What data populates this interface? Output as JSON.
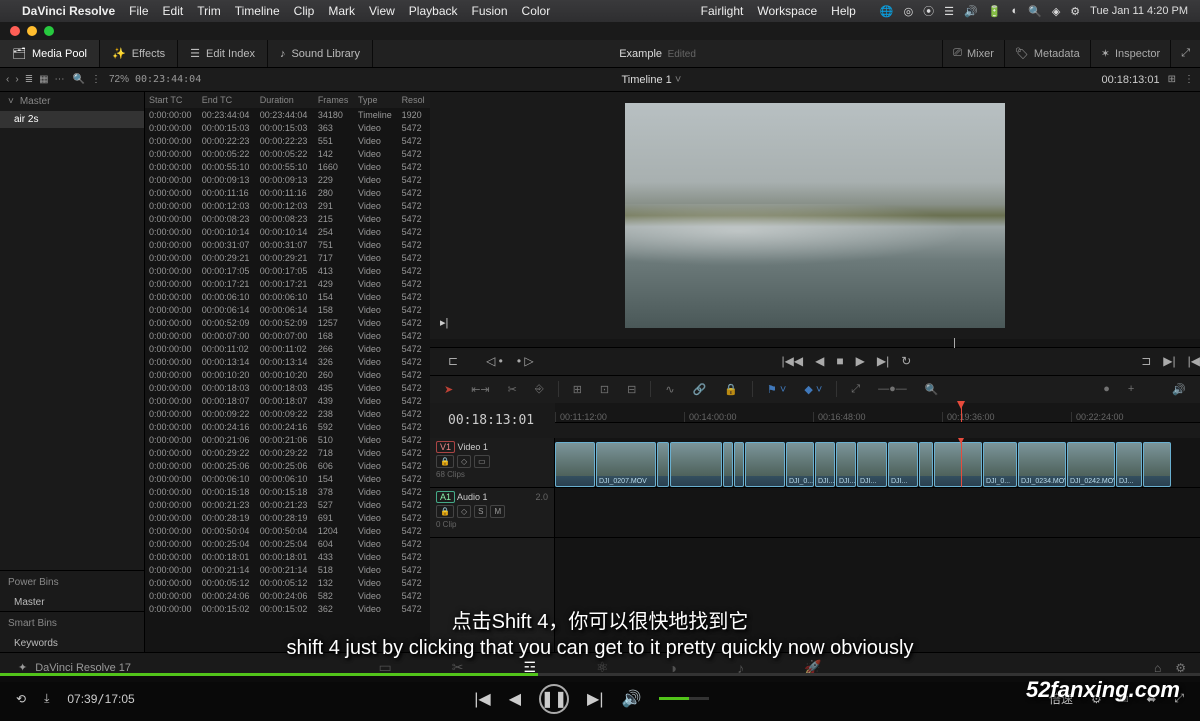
{
  "menubar": {
    "app": "DaVinci Resolve",
    "items": [
      "File",
      "Edit",
      "Trim",
      "Timeline",
      "Clip",
      "Mark",
      "View",
      "Playback",
      "Fusion",
      "Color"
    ],
    "right_items": [
      "Fairlight",
      "Workspace",
      "Help"
    ],
    "clock": "Tue Jan 11  4:20 PM"
  },
  "tabbar": {
    "media_pool": "Media Pool",
    "effects": "Effects",
    "edit_index": "Edit Index",
    "sound_library": "Sound Library",
    "title": "Example",
    "subtitle": "Edited",
    "mixer": "Mixer",
    "metadata": "Metadata",
    "inspector": "Inspector"
  },
  "subbar": {
    "zoom": "72%",
    "tc": "00:23:44:04",
    "timeline_name": "Timeline 1",
    "right_tc": "00:18:13:01"
  },
  "bins": {
    "master": "Master",
    "folder": "air 2s",
    "power_bins": "Power Bins",
    "power_master": "Master",
    "smart_bins": "Smart Bins",
    "keywords": "Keywords"
  },
  "media_table": {
    "headers": [
      "Start TC",
      "End TC",
      "Duration",
      "Frames",
      "Type",
      "Resol"
    ],
    "rows": [
      [
        "0:00:00:00",
        "00:23:44:04",
        "00:23:44:04",
        "34180",
        "Timeline",
        "1920"
      ],
      [
        "0:00:00:00",
        "00:00:15:03",
        "00:00:15:03",
        "363",
        "Video",
        "5472"
      ],
      [
        "0:00:00:00",
        "00:00:22:23",
        "00:00:22:23",
        "551",
        "Video",
        "5472"
      ],
      [
        "0:00:00:00",
        "00:00:05:22",
        "00:00:05:22",
        "142",
        "Video",
        "5472"
      ],
      [
        "0:00:00:00",
        "00:00:55:10",
        "00:00:55:10",
        "1660",
        "Video",
        "5472"
      ],
      [
        "0:00:00:00",
        "00:00:09:13",
        "00:00:09:13",
        "229",
        "Video",
        "5472"
      ],
      [
        "0:00:00:00",
        "00:00:11:16",
        "00:00:11:16",
        "280",
        "Video",
        "5472"
      ],
      [
        "0:00:00:00",
        "00:00:12:03",
        "00:00:12:03",
        "291",
        "Video",
        "5472"
      ],
      [
        "0:00:00:00",
        "00:00:08:23",
        "00:00:08:23",
        "215",
        "Video",
        "5472"
      ],
      [
        "0:00:00:00",
        "00:00:10:14",
        "00:00:10:14",
        "254",
        "Video",
        "5472"
      ],
      [
        "0:00:00:00",
        "00:00:31:07",
        "00:00:31:07",
        "751",
        "Video",
        "5472"
      ],
      [
        "0:00:00:00",
        "00:00:29:21",
        "00:00:29:21",
        "717",
        "Video",
        "5472"
      ],
      [
        "0:00:00:00",
        "00:00:17:05",
        "00:00:17:05",
        "413",
        "Video",
        "5472"
      ],
      [
        "0:00:00:00",
        "00:00:17:21",
        "00:00:17:21",
        "429",
        "Video",
        "5472"
      ],
      [
        "0:00:00:00",
        "00:00:06:10",
        "00:00:06:10",
        "154",
        "Video",
        "5472"
      ],
      [
        "0:00:00:00",
        "00:00:06:14",
        "00:00:06:14",
        "158",
        "Video",
        "5472"
      ],
      [
        "0:00:00:00",
        "00:00:52:09",
        "00:00:52:09",
        "1257",
        "Video",
        "5472"
      ],
      [
        "0:00:00:00",
        "00:00:07:00",
        "00:00:07:00",
        "168",
        "Video",
        "5472"
      ],
      [
        "0:00:00:00",
        "00:00:11:02",
        "00:00:11:02",
        "266",
        "Video",
        "5472"
      ],
      [
        "0:00:00:00",
        "00:00:13:14",
        "00:00:13:14",
        "326",
        "Video",
        "5472"
      ],
      [
        "0:00:00:00",
        "00:00:10:20",
        "00:00:10:20",
        "260",
        "Video",
        "5472"
      ],
      [
        "0:00:00:00",
        "00:00:18:03",
        "00:00:18:03",
        "435",
        "Video",
        "5472"
      ],
      [
        "0:00:00:00",
        "00:00:18:07",
        "00:00:18:07",
        "439",
        "Video",
        "5472"
      ],
      [
        "0:00:00:00",
        "00:00:09:22",
        "00:00:09:22",
        "238",
        "Video",
        "5472"
      ],
      [
        "0:00:00:00",
        "00:00:24:16",
        "00:00:24:16",
        "592",
        "Video",
        "5472"
      ],
      [
        "0:00:00:00",
        "00:00:21:06",
        "00:00:21:06",
        "510",
        "Video",
        "5472"
      ],
      [
        "0:00:00:00",
        "00:00:29:22",
        "00:00:29:22",
        "718",
        "Video",
        "5472"
      ],
      [
        "0:00:00:00",
        "00:00:25:06",
        "00:00:25:06",
        "606",
        "Video",
        "5472"
      ],
      [
        "0:00:00:00",
        "00:00:06:10",
        "00:00:06:10",
        "154",
        "Video",
        "5472"
      ],
      [
        "0:00:00:00",
        "00:00:15:18",
        "00:00:15:18",
        "378",
        "Video",
        "5472"
      ],
      [
        "0:00:00:00",
        "00:00:21:23",
        "00:00:21:23",
        "527",
        "Video",
        "5472"
      ],
      [
        "0:00:00:00",
        "00:00:28:19",
        "00:00:28:19",
        "691",
        "Video",
        "5472"
      ],
      [
        "0:00:00:00",
        "00:00:50:04",
        "00:00:50:04",
        "1204",
        "Video",
        "5472"
      ],
      [
        "0:00:00:00",
        "00:00:25:04",
        "00:00:25:04",
        "604",
        "Video",
        "5472"
      ],
      [
        "0:00:00:00",
        "00:00:18:01",
        "00:00:18:01",
        "433",
        "Video",
        "5472"
      ],
      [
        "0:00:00:00",
        "00:00:21:14",
        "00:00:21:14",
        "518",
        "Video",
        "5472"
      ],
      [
        "0:00:00:00",
        "00:00:05:12",
        "00:00:05:12",
        "132",
        "Video",
        "5472"
      ],
      [
        "0:00:00:00",
        "00:00:24:06",
        "00:00:24:06",
        "582",
        "Video",
        "5472"
      ],
      [
        "0:00:00:00",
        "00:00:15:02",
        "00:00:15:02",
        "362",
        "Video",
        "5472"
      ]
    ]
  },
  "timeline": {
    "tc_display": "00:18:13:01",
    "ruler": [
      "00:11:12:00",
      "00:14:00:00",
      "00:16:48:00",
      "00:19:36:00",
      "00:22:24:00"
    ],
    "video_track": {
      "id": "V1",
      "name": "Video 1",
      "clips_info": "68 Clips"
    },
    "audio_track": {
      "id": "A1",
      "name": "Audio 1",
      "level": "2.0",
      "clips_info": "0 Clip"
    },
    "clips": [
      {
        "w": 40,
        "label": ""
      },
      {
        "w": 60,
        "label": "DJI_0207.MOV"
      },
      {
        "w": 12,
        "label": ""
      },
      {
        "w": 52,
        "label": ""
      },
      {
        "w": 10,
        "label": ""
      },
      {
        "w": 10,
        "label": ""
      },
      {
        "w": 40,
        "label": ""
      },
      {
        "w": 28,
        "label": "DJI_0..."
      },
      {
        "w": 20,
        "label": "DJI..."
      },
      {
        "w": 20,
        "label": "DJI..."
      },
      {
        "w": 30,
        "label": "DJI..."
      },
      {
        "w": 30,
        "label": "DJI..."
      },
      {
        "w": 14,
        "label": ""
      },
      {
        "w": 48,
        "label": ""
      },
      {
        "w": 34,
        "label": "DJI_0..."
      },
      {
        "w": 48,
        "label": "DJI_0234.MOV"
      },
      {
        "w": 48,
        "label": "DJI_0242.MOV"
      },
      {
        "w": 26,
        "label": "DJ..."
      },
      {
        "w": 28,
        "label": ""
      }
    ]
  },
  "page_nav": {
    "label": "DaVinci Resolve 17"
  },
  "subtitles": {
    "cn": "点击Shift 4，你可以很快地找到它",
    "en": "shift 4 just by clicking that you can get to it pretty quickly now obviously"
  },
  "watermark": "52fanxing.com",
  "player": {
    "current": "07:39",
    "total": "17:05",
    "speed": "倍速"
  }
}
